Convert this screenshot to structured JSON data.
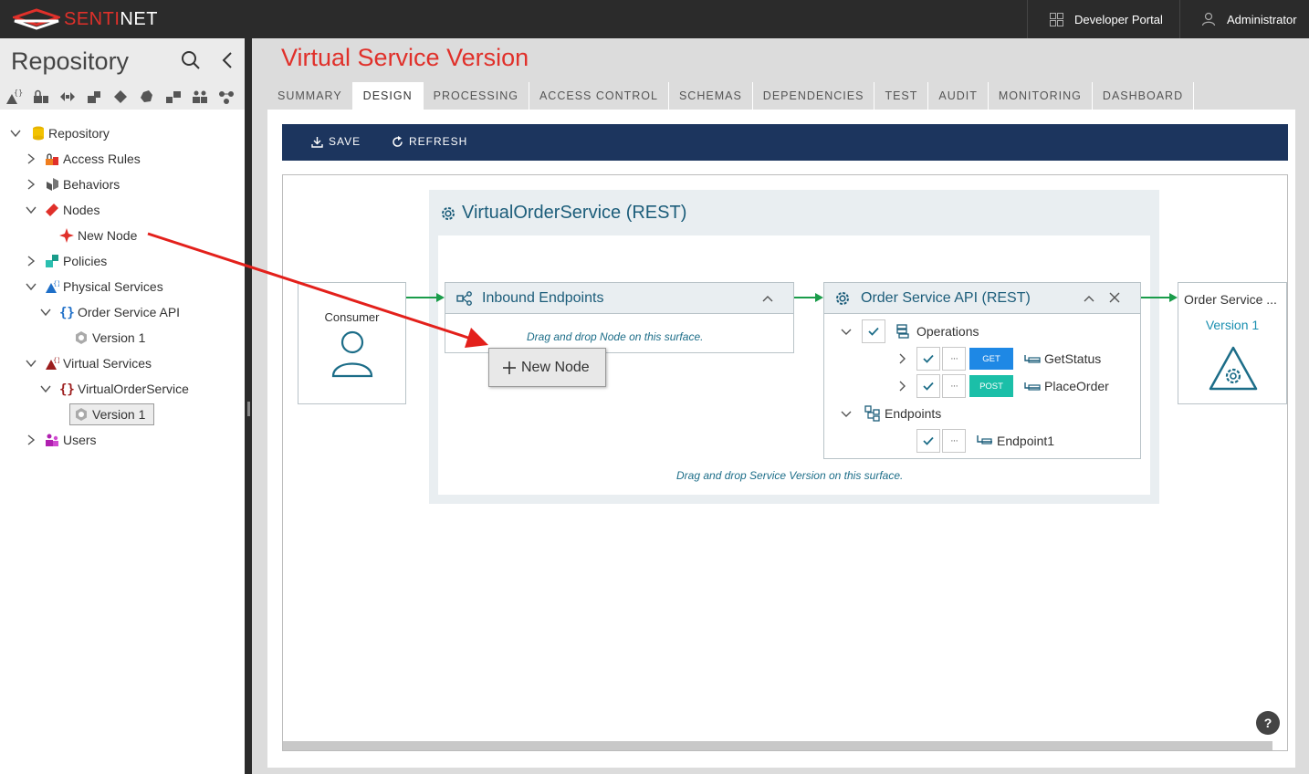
{
  "topbar": {
    "brand": "SENTINET",
    "brand_prefix": "SENTI",
    "brand_suffix": "NET",
    "developer_portal": "Developer Portal",
    "user": "Administrator"
  },
  "sidebar": {
    "title": "Repository",
    "filter_icons": [
      "braces-icon",
      "lock-icon",
      "behavior-icon",
      "policy-icon",
      "node-icon",
      "hexagon-icon",
      "blocks-icon",
      "users-icon",
      "relations-icon"
    ],
    "tree": [
      {
        "label": "Repository",
        "expanded": true,
        "icon": "database-icon"
      },
      {
        "label": "Access Rules",
        "expanded": false,
        "icon": "lock-icon"
      },
      {
        "label": "Behaviors",
        "expanded": false,
        "icon": "behavior-icon"
      },
      {
        "label": "Nodes",
        "expanded": true,
        "icon": "node-icon"
      },
      {
        "label": "New Node",
        "icon": "new-node-icon"
      },
      {
        "label": "Policies",
        "expanded": false,
        "icon": "policy-icon"
      },
      {
        "label": "Physical Services",
        "expanded": true,
        "icon": "physical-services-icon"
      },
      {
        "label": "Order Service API",
        "expanded": true,
        "icon": "braces-icon"
      },
      {
        "label": "Version 1",
        "icon": "version-icon"
      },
      {
        "label": "Virtual Services",
        "expanded": true,
        "icon": "virtual-services-icon"
      },
      {
        "label": "VirtualOrderService",
        "expanded": true,
        "icon": "braces-icon"
      },
      {
        "label": "Version 1",
        "icon": "version-icon",
        "selected": true
      },
      {
        "label": "Users",
        "expanded": false,
        "icon": "users-icon"
      }
    ]
  },
  "main": {
    "title": "Virtual Service Version",
    "tabs": [
      {
        "label": "SUMMARY",
        "active": false
      },
      {
        "label": "DESIGN",
        "active": true
      },
      {
        "label": "PROCESSING",
        "active": false
      },
      {
        "label": "ACCESS CONTROL",
        "active": false
      },
      {
        "label": "SCHEMAS",
        "active": false
      },
      {
        "label": "DEPENDENCIES",
        "active": false
      },
      {
        "label": "TEST",
        "active": false
      },
      {
        "label": "AUDIT",
        "active": false
      },
      {
        "label": "MONITORING",
        "active": false
      },
      {
        "label": "DASHBOARD",
        "active": false
      }
    ],
    "toolbar": {
      "save": "SAVE",
      "refresh": "REFRESH"
    }
  },
  "design": {
    "virtual_service": "VirtualOrderService (REST)",
    "consumer": "Consumer",
    "inbound": {
      "title": "Inbound Endpoints",
      "hint": "Drag and drop Node on this surface."
    },
    "order_service": {
      "title": "Order Service API (REST)",
      "operations_label": "Operations",
      "operations": [
        {
          "verb": "GET",
          "name": "GetStatus",
          "color": "#1e88e5"
        },
        {
          "verb": "POST",
          "name": "PlaceOrder",
          "color": "#1bbfa8"
        }
      ],
      "endpoints_label": "Endpoints",
      "endpoints": [
        "Endpoint1"
      ],
      "more": "···"
    },
    "service_hint": "Drag and drop Service Version on this surface.",
    "target": {
      "label": "Order Service ...",
      "version": "Version 1"
    },
    "drag_node": "New Node",
    "help": "?"
  },
  "colors": {
    "accent": "#e0302a",
    "toolbar": "#1c355e",
    "title_blue": "#1c5d7a",
    "arrow": "#e3201b",
    "flow": "#1a9c4a"
  }
}
